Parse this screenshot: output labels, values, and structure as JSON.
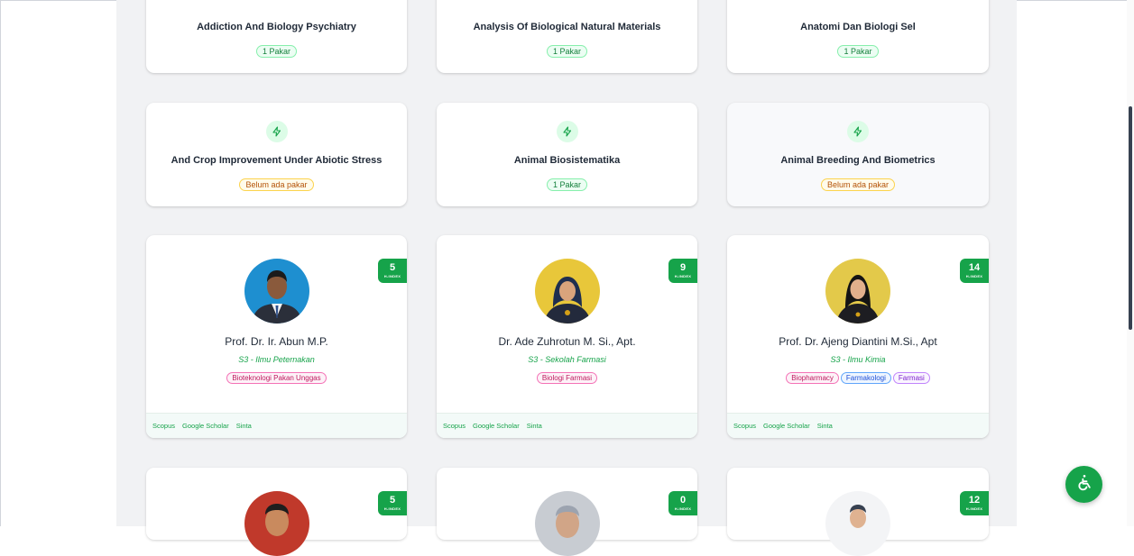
{
  "fields_row1": [
    {
      "title": "Addiction And Biology Psychiatry",
      "badge": "1 Pakar",
      "badge_type": "green"
    },
    {
      "title": "Analysis Of Biological Natural Materials",
      "badge": "1 Pakar",
      "badge_type": "green"
    },
    {
      "title": "Anatomi Dan Biologi Sel",
      "badge": "1 Pakar",
      "badge_type": "green"
    }
  ],
  "fields_row2": [
    {
      "title": "And Crop Improvement Under Abiotic Stress",
      "badge": "Belum ada pakar",
      "badge_type": "amber",
      "icon": "bolt-icon"
    },
    {
      "title": "Animal Biosistematika",
      "badge": "1 Pakar",
      "badge_type": "green",
      "icon": "bolt-icon"
    },
    {
      "title": "Animal Breeding And Biometrics",
      "badge": "Belum ada pakar",
      "badge_type": "amber",
      "icon": "bolt-icon"
    }
  ],
  "h_index_label": "H-INDEX",
  "experts": [
    {
      "hindex": "5",
      "name": "Prof. Dr. Ir. Abun M.P.",
      "dept": "S3 - Ilmu Peternakan",
      "tags": [
        {
          "label": "Bioteknologi Pakan Unggas",
          "color": "pink"
        }
      ]
    },
    {
      "hindex": "9",
      "name": "Dr. Ade Zuhrotun M. Si., Apt.",
      "dept": "S3 - Sekolah Farmasi",
      "tags": [
        {
          "label": "Biologi Farmasi",
          "color": "pink"
        }
      ]
    },
    {
      "hindex": "14",
      "name": "Prof. Dr. Ajeng Diantini M.Si., Apt",
      "dept": "S3 - Ilmu Kimia",
      "tags": [
        {
          "label": "Biopharmacy",
          "color": "pink"
        },
        {
          "label": "Farmakologi",
          "color": "blue"
        },
        {
          "label": "Farmasi",
          "color": "purple"
        }
      ]
    }
  ],
  "expert_links": {
    "scopus": "Scopus",
    "google_scholar": "Google Scholar",
    "sinta": "Sinta"
  },
  "experts_row2_hindex": [
    "5",
    "0",
    "12"
  ],
  "colors": {
    "accent": "#16a34a",
    "page_bg": "#f1f2f4"
  },
  "floating_button": {
    "icon": "accessibility-icon"
  }
}
